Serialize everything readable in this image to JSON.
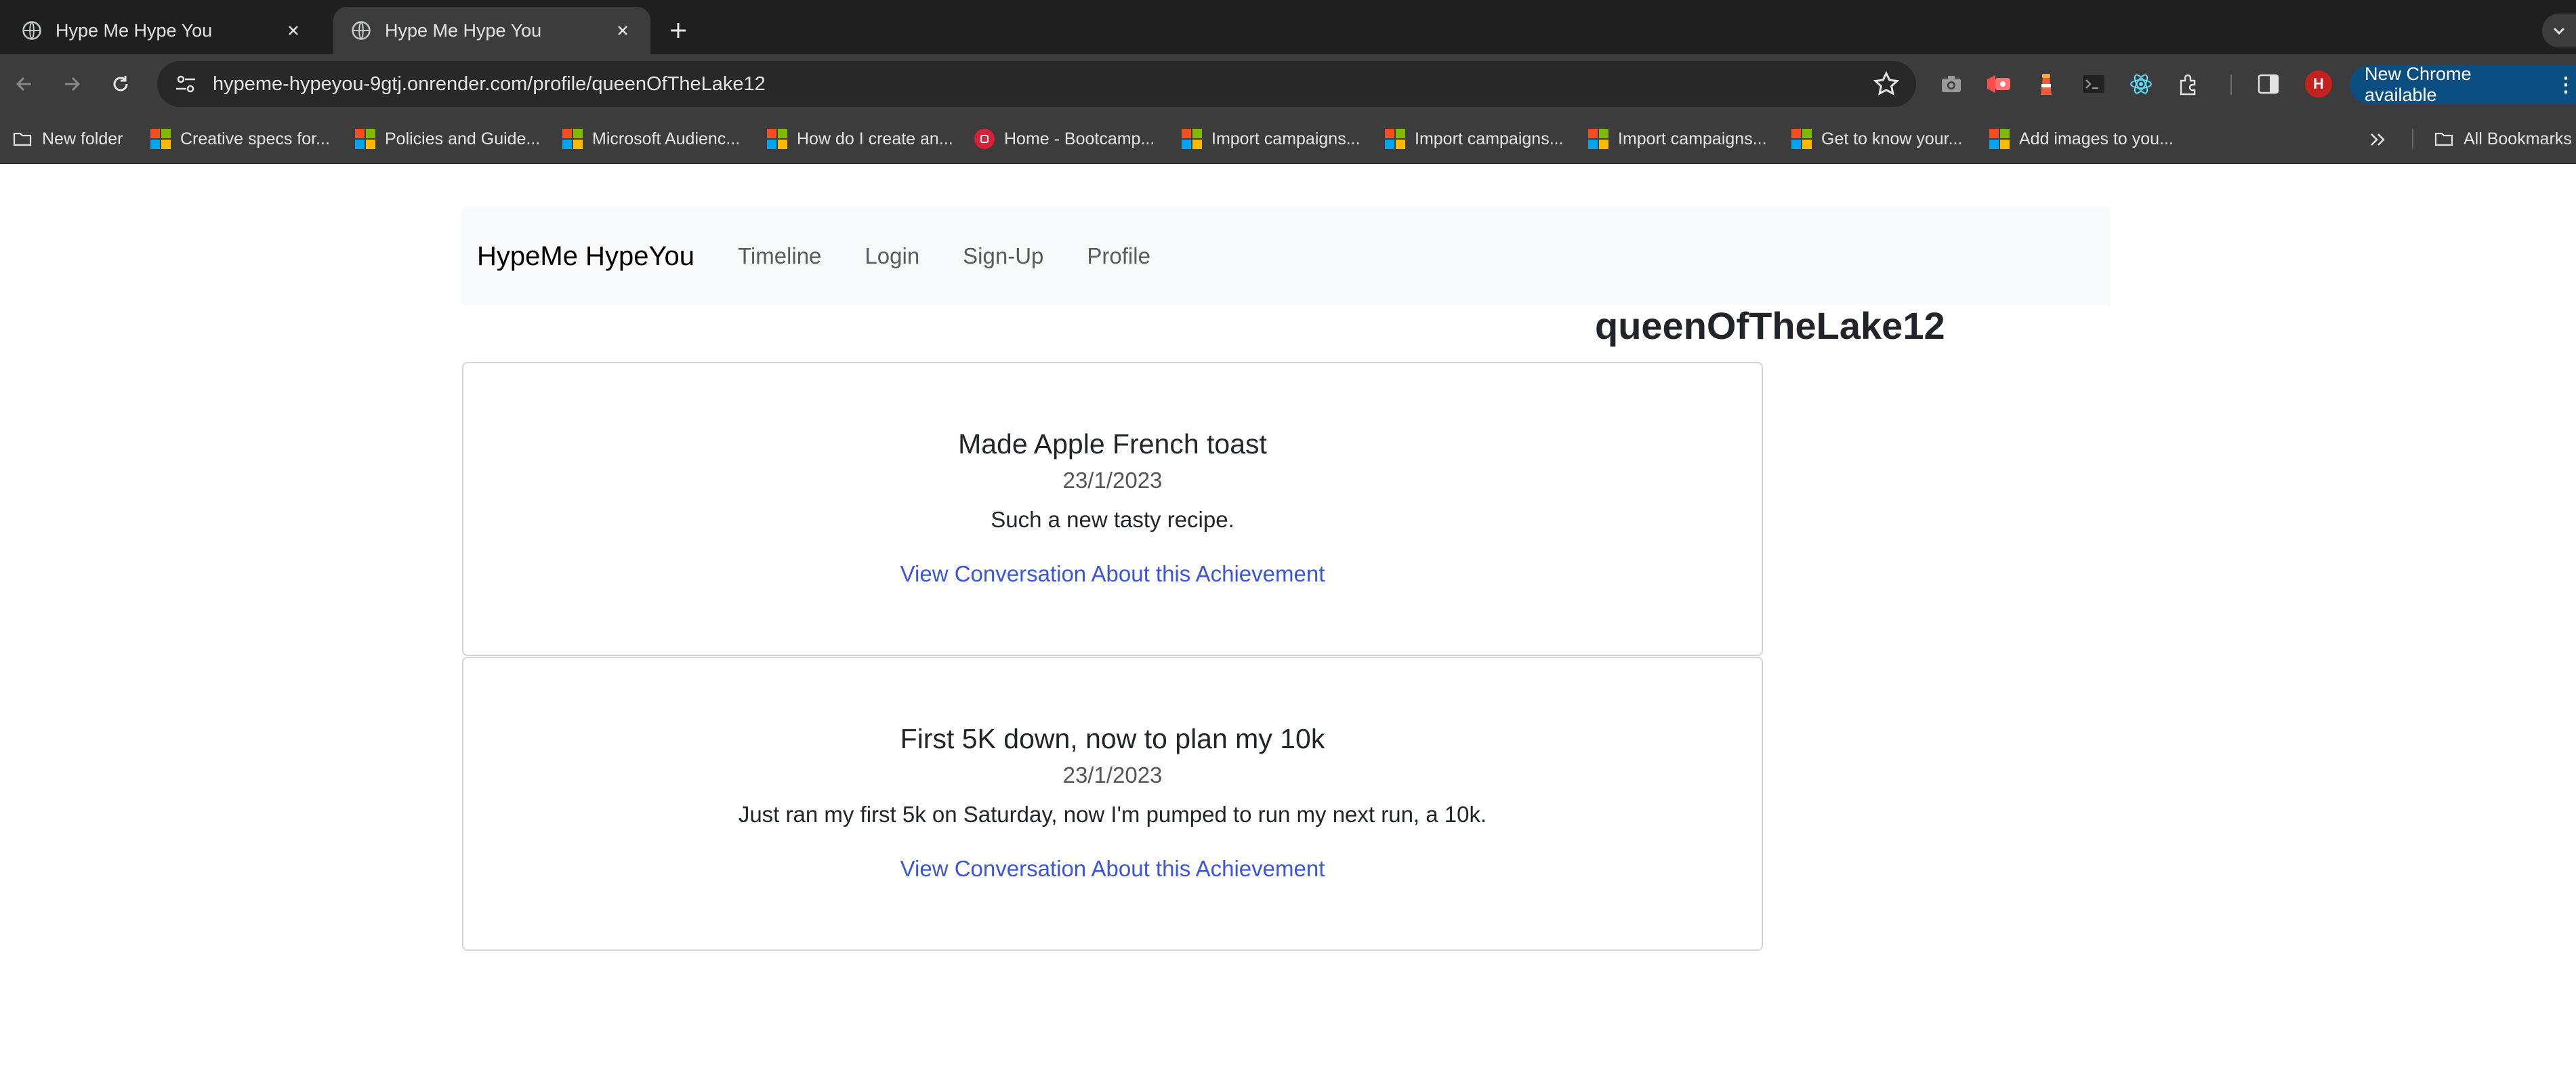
{
  "browser": {
    "tabs": [
      {
        "title": "Hype Me Hype You",
        "active": false
      },
      {
        "title": "Hype Me Hype You",
        "active": true
      }
    ],
    "url": "hypeme-hypeyou-9gtj.onrender.com/profile/queenOfTheLake12",
    "avatar_letter": "H",
    "update_label": "New Chrome available",
    "bookmarks": [
      {
        "label": "New folder",
        "icon": "folder-icon"
      },
      {
        "label": "Creative specs for...",
        "icon": "microsoft-icon"
      },
      {
        "label": "Policies and Guide...",
        "icon": "microsoft-icon"
      },
      {
        "label": "Microsoft Audienc...",
        "icon": "microsoft-icon"
      },
      {
        "label": "How do I create an...",
        "icon": "microsoft-icon"
      },
      {
        "label": "Home - Bootcamp...",
        "icon": "bootcamp-icon"
      },
      {
        "label": "Import campaigns...",
        "icon": "microsoft-icon"
      },
      {
        "label": "Import campaigns...",
        "icon": "microsoft-icon"
      },
      {
        "label": "Import campaigns...",
        "icon": "microsoft-icon"
      },
      {
        "label": "Get to know your...",
        "icon": "microsoft-icon"
      },
      {
        "label": "Add images to you...",
        "icon": "microsoft-icon"
      }
    ],
    "all_bookmarks_label": "All Bookmarks"
  },
  "site": {
    "brand": "HypeMe HypeYou",
    "nav": [
      "Timeline",
      "Login",
      "Sign-Up",
      "Profile"
    ]
  },
  "profile": {
    "username": "queenOfTheLake12",
    "achievements": [
      {
        "title": "Made Apple French toast",
        "date": "23/1/2023",
        "body": "Such a new tasty recipe.",
        "link": "View Conversation About this Achievement"
      },
      {
        "title": "First 5K down, now to plan my 10k",
        "date": "23/1/2023",
        "body": "Just ran my first 5k on Saturday, now I'm pumped to run my next run, a 10k.",
        "link": "View Conversation About this Achievement"
      }
    ]
  },
  "colors": {
    "link": "#3b54e2",
    "navbar_bg": "#f8f9fa",
    "update_button": "#0b4f82"
  }
}
